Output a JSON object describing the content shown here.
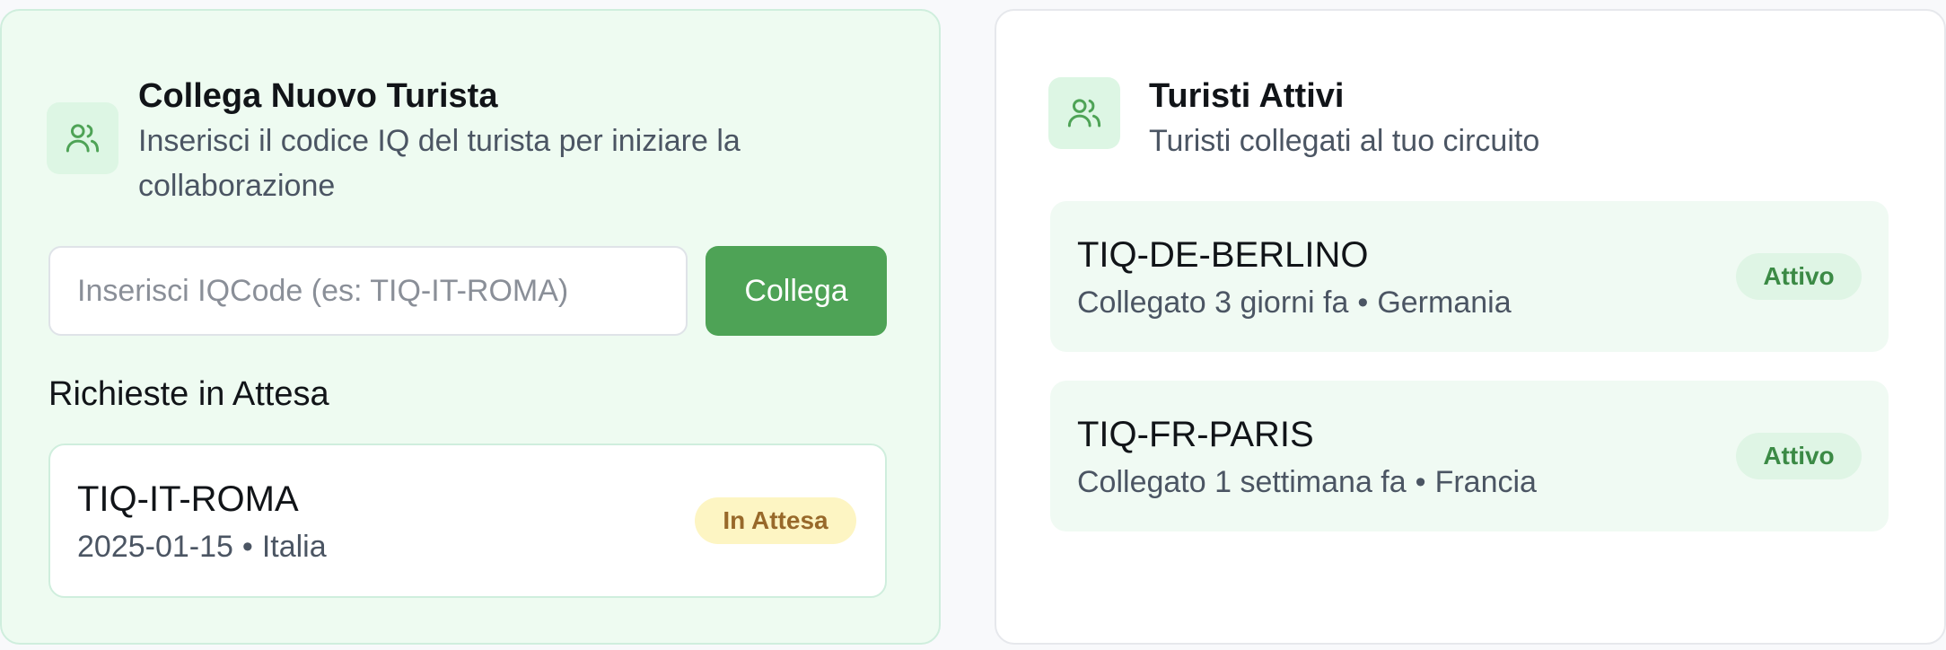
{
  "connect": {
    "title": "Collega Nuovo Turista",
    "subtitle": "Inserisci il codice IQ del turista per iniziare la collaborazione",
    "input_placeholder": "Inserisci IQCode (es: TIQ-IT-ROMA)",
    "input_value": "",
    "button_label": "Collega",
    "icon": "users-icon"
  },
  "pending": {
    "heading": "Richieste in Attesa",
    "items": [
      {
        "code": "TIQ-IT-ROMA",
        "date": "2025-01-15",
        "separator": "•",
        "country": "Italia",
        "status": "In Attesa"
      }
    ]
  },
  "active": {
    "title": "Turisti Attivi",
    "subtitle": "Turisti collegati al tuo circuito",
    "icon": "users-icon",
    "items": [
      {
        "code": "TIQ-DE-BERLINO",
        "connected": "Collegato 3 giorni fa",
        "separator": "•",
        "country": "Germania",
        "status": "Attivo"
      },
      {
        "code": "TIQ-FR-PARIS",
        "connected": "Collegato 1 settimana fa",
        "separator": "•",
        "country": "Francia",
        "status": "Attivo"
      }
    ]
  },
  "colors": {
    "accent_green": "#4ea356",
    "pending_badge_bg": "#fdf5c3",
    "pending_badge_text": "#98692a",
    "active_badge_bg": "#dff5e5",
    "active_badge_text": "#3b8a45"
  }
}
